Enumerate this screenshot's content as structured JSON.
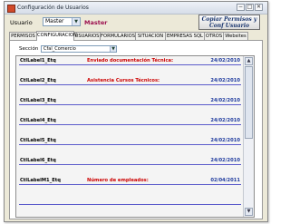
{
  "window": {
    "title": "Configuración de Usuarios"
  },
  "user": {
    "label": "Usuario",
    "selected": "Master",
    "display_name": "Master"
  },
  "copy_button": {
    "label": "Copiar Permisos y Conf Usuario"
  },
  "tabs": [
    {
      "label": "PERMISOS"
    },
    {
      "label": "CONFIGURACION"
    },
    {
      "label": "USUARIOS"
    },
    {
      "label": "FORMULARIOS"
    },
    {
      "label": "SITUACION"
    },
    {
      "label": "EMPRESAS SQL"
    },
    {
      "label": "OTROS"
    },
    {
      "label": "Websites"
    }
  ],
  "seccion": {
    "label": "Sección",
    "selected": "Cfal_Comercio"
  },
  "rows": [
    {
      "name": "CtlLabel1_Etq",
      "desc": "Enviado documentación Técnica:",
      "date": "24/02/2010"
    },
    {
      "name": "CtlLabel2_Etq",
      "desc": "Asistencia Cursos Técnicos:",
      "date": "24/02/2010"
    },
    {
      "name": "CtlLabel3_Etq",
      "desc": "",
      "date": "24/02/2010"
    },
    {
      "name": "CtlLabel4_Etq",
      "desc": "",
      "date": "24/02/2010"
    },
    {
      "name": "CtlLabel5_Etq",
      "desc": "",
      "date": "24/02/2010"
    },
    {
      "name": "CtlLabel6_Etq",
      "desc": "",
      "date": "24/02/2010"
    },
    {
      "name": "CtlLabelM1_Etq",
      "desc": "Número de empleados:",
      "date": "02/04/2011"
    },
    {
      "name": "",
      "desc": "",
      "date": ""
    }
  ]
}
